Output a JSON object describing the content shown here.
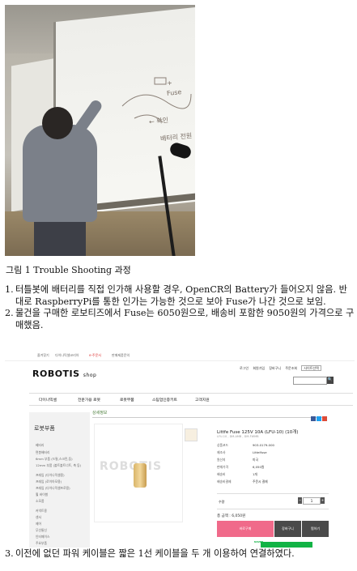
{
  "figure": {
    "caption": "그림 1 Trouble Shooting 과정",
    "board_scribbles": [
      "+",
      "Fuse",
      "← 확인",
      "배터리 전원"
    ]
  },
  "notes": [
    {
      "num": "1.",
      "text": "터틀봇에 배터리를 직접 인가해 사용할 경우, OpenCR의 Battery가 들어오지 않음. 반대로 RaspberryPi를 통한 인가는 가능한 것으로 보아 Fuse가 나간 것으로 보임."
    },
    {
      "num": "2.",
      "text": "물건을 구매한 로보티즈에서 Fuse는 6050원으로, 배송비 포함한 9050원의 가격으로 구매했음."
    },
    {
      "num": "3.",
      "text": "이전에 없던 파워 케이블은 짧은 1선 케이블을 두 개 이용하여 연결하였다."
    }
  ],
  "store": {
    "topbar": [
      "즐겨찾기",
      "다이나믹셀코리아",
      "e-주문서",
      "판매제품문의"
    ],
    "logo_main": "ROBOTIS",
    "logo_sub": "shop",
    "utility": [
      "로그인",
      "회원가입",
      "장바구니",
      "주문조회",
      "사이트선택"
    ],
    "search_button": "🔍",
    "nav": [
      "다이나믹셀",
      "전문가용 로봇",
      "로봇부품",
      "스팀업인증키트",
      "고객지원"
    ],
    "sidebar": {
      "title": "로봇부품",
      "items": [
        "베터리",
        "면봉배터리",
        "6mm 부품 (드릴,스크린,등)",
        "12mm 부품 (볼트볼트너트, 축 등)",
        "프레임 (다이나믹셀용)",
        "프레임 (로이아모용)",
        "프레임 (다이나믹셀프로용)",
        "휠 바이벌",
        "소모품",
        "커넥트용",
        "센서",
        "제어",
        "무선통신",
        "인터페이스",
        "주요부품"
      ]
    },
    "detail_title": "상세정보",
    "watermark": "ROBOTIS",
    "product_name": "Littfe Fuse 125V 10A (LFU-10) (10개)",
    "product_sub": "LFU-10 , DM-AMB , DM-FWMB",
    "specs": [
      {
        "label": "상품코드",
        "value": "903-0179-000"
      },
      {
        "label": "제조사",
        "value": "Littelfuse"
      },
      {
        "label": "원산지",
        "value": "미국"
      },
      {
        "label": "판매가격",
        "value": "6,050원"
      },
      {
        "label": "배송비",
        "value": "1개"
      },
      {
        "label": "배송비결제",
        "value": "주문시 결제"
      }
    ],
    "qty_label": "수량",
    "qty_value": "1",
    "total": "총 금액 : 6,050원",
    "buttons": {
      "buy": "바로구매",
      "cart": "장바구니",
      "wish": "찜하기"
    },
    "naver_label": "NAVER",
    "colors": {
      "accent_green": "#4a7d3a",
      "buy_pink": "#f06a8a",
      "naver_green": "#12b345"
    }
  }
}
